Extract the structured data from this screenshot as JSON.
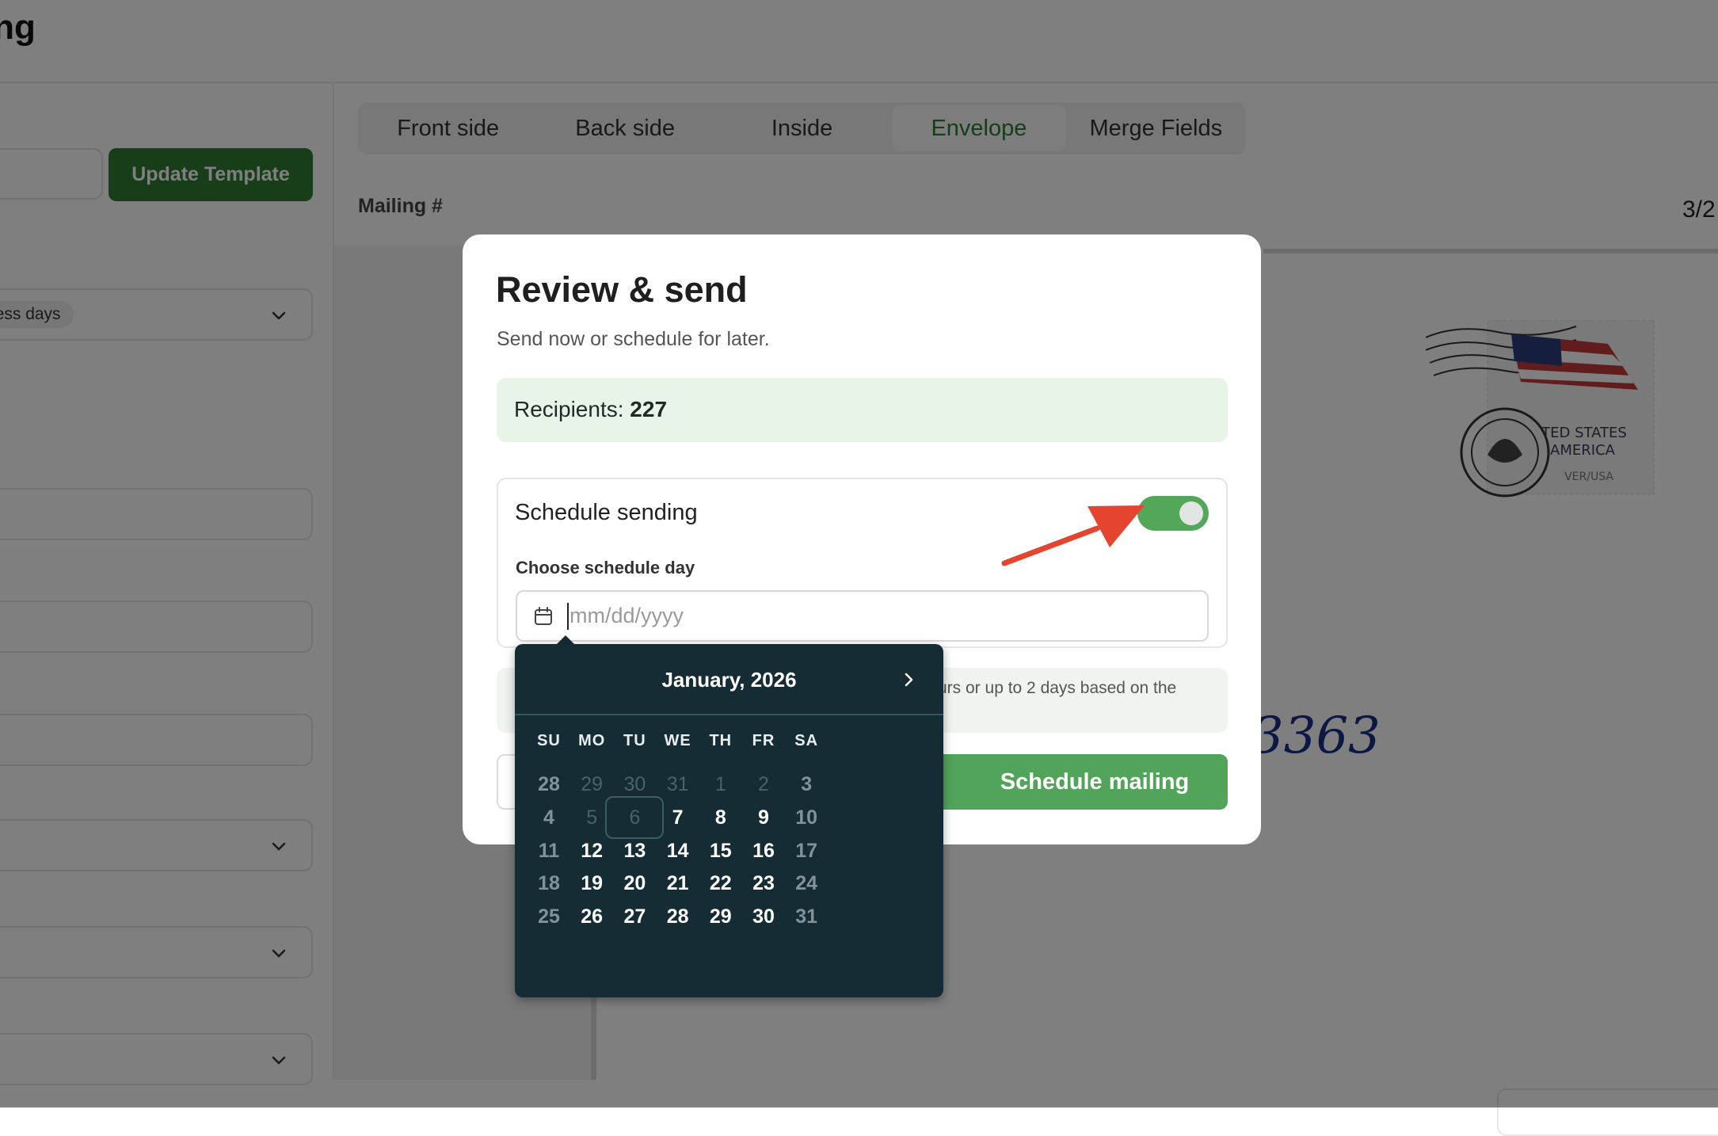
{
  "app": {
    "page_title": "ailing"
  },
  "sidebar": {
    "update_button": "Update Template",
    "delivery_chip": "ness days"
  },
  "tabs": [
    {
      "label": "Front side"
    },
    {
      "label": "Back side"
    },
    {
      "label": "Inside"
    },
    {
      "label": "Envelope",
      "active": true
    },
    {
      "label": "Merge Fields"
    }
  ],
  "preview": {
    "mailing_label": "Mailing #",
    "mailing_right": "3/2",
    "stamp_text_1": "TED STATES",
    "stamp_text_2": "AMERICA",
    "stamp_text_3": "VER/USA",
    "handwritten_number": "3363"
  },
  "modal": {
    "title": "Review & send",
    "subtitle": "Send now or schedule for later.",
    "recipients_label": "Recipients:",
    "recipients_count": "227",
    "schedule_title": "Schedule sending",
    "schedule_enabled": true,
    "choose_day_label": "Choose schedule day",
    "date_placeholder": "mm/dd/yyyy",
    "info_text": "urs or up to 2 days based on the",
    "schedule_button": "Schedule mailing"
  },
  "datepicker": {
    "month_label": "January, 2026",
    "weekdays": [
      "SU",
      "MO",
      "TU",
      "WE",
      "TH",
      "FR",
      "SA"
    ],
    "weeks": [
      [
        "28",
        "29",
        "30",
        "31",
        "1",
        "2",
        "3"
      ],
      [
        "4",
        "5",
        "6",
        "7",
        "8",
        "9",
        "10"
      ],
      [
        "11",
        "12",
        "13",
        "14",
        "15",
        "16",
        "17"
      ],
      [
        "18",
        "19",
        "20",
        "21",
        "22",
        "23",
        "24"
      ],
      [
        "25",
        "26",
        "27",
        "28",
        "29",
        "30",
        "31"
      ]
    ],
    "disabled_days": [
      [
        0,
        1
      ],
      [
        0,
        2
      ],
      [
        0,
        3
      ],
      [
        0,
        4
      ],
      [
        0,
        5
      ],
      [
        1,
        1
      ],
      [
        1,
        2
      ]
    ],
    "weekend_days_muted": true,
    "today_cell": [
      1,
      2
    ]
  },
  "colors": {
    "accent_green": "#2f7d32",
    "button_green": "#52a45a",
    "toggle_on": "#52a858",
    "datepicker_bg": "#152c35",
    "annotation_arrow": "#e5442f",
    "recipients_bg": "#e9f4e9"
  }
}
